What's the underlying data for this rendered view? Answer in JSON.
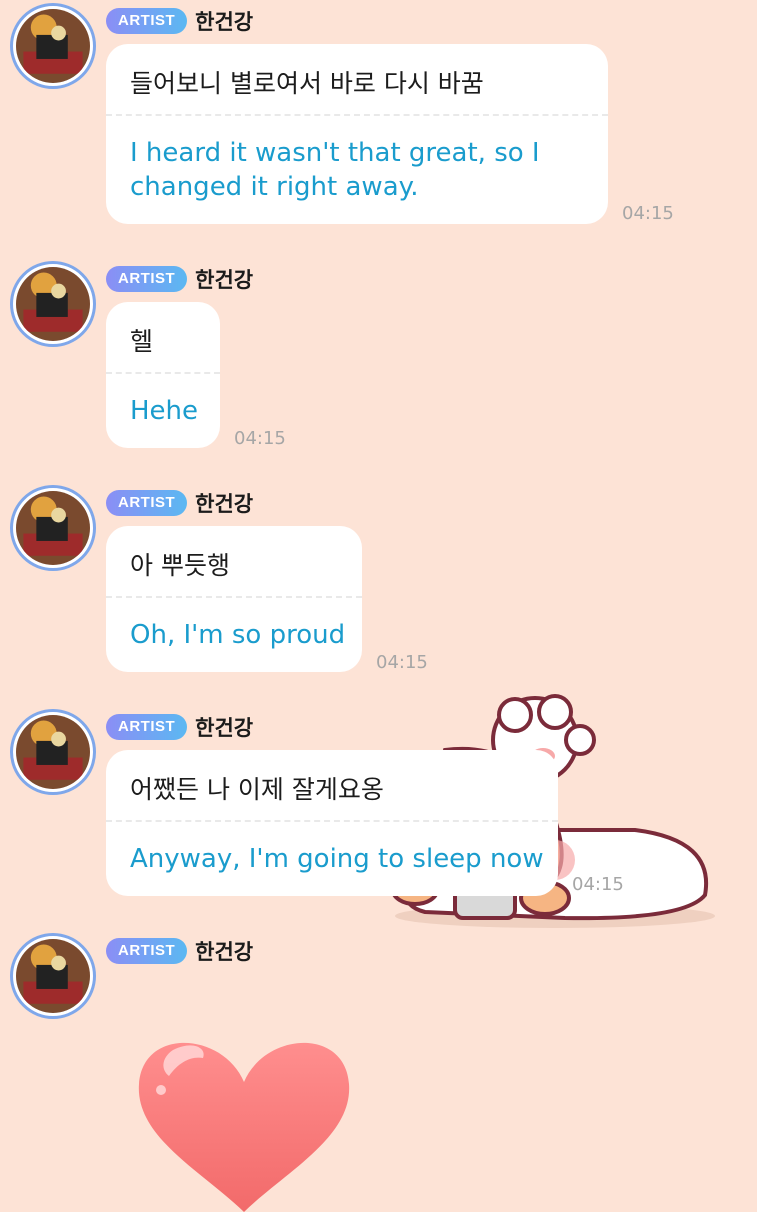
{
  "sender": {
    "badge": "ARTIST",
    "name": "한건강"
  },
  "messages": [
    {
      "original": "들어보니 별로여서 바로 다시 바꿈",
      "translation": "I heard it wasn't that great, so I changed it right away.",
      "time": "04:15"
    },
    {
      "original": "헬",
      "translation": "Hehe",
      "time": "04:15"
    },
    {
      "original": "아 뿌듯행",
      "translation": "Oh, I'm so proud",
      "time": "04:15"
    },
    {
      "original": "어쨌든 나 이제 잘게요옹",
      "translation": "Anyway, I'm going to sleep now",
      "time": "04:15"
    }
  ],
  "stickers": {
    "sleeping": "sheep-sleeping-sticker",
    "heart": "heart-emoji"
  },
  "colors": {
    "background": "#fde3d6",
    "translation_text": "#1a9ccd",
    "badge_start": "#8b8ef5",
    "badge_end": "#5bb8f2",
    "avatar_ring": "#7fa7ea"
  }
}
